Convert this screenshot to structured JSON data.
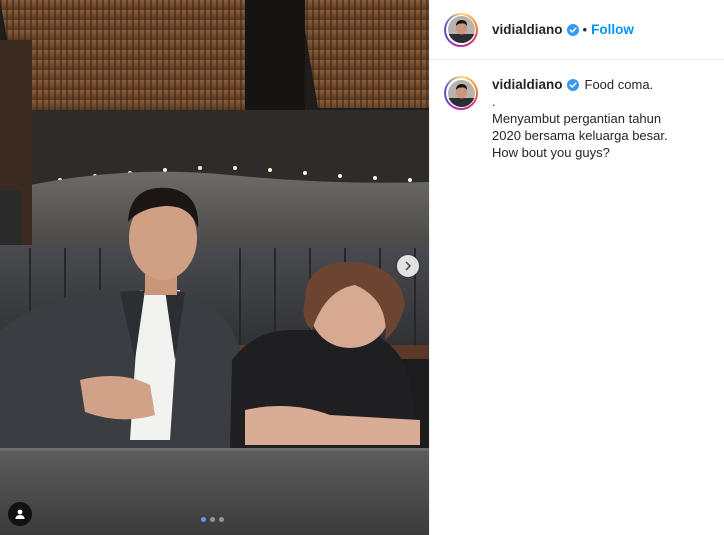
{
  "post": {
    "author": {
      "username": "vidialdiano",
      "verified": true
    },
    "follow_label": "Follow",
    "separator": "•",
    "caption": {
      "first_line": "Food coma.",
      "dot_line": ".",
      "body": "Menyambut pergantian tahun 2020 bersama keluarga besar. How bout you guys?"
    },
    "carousel": {
      "total": 3,
      "current": 1
    },
    "icons": {
      "verified": "verified-badge-icon",
      "next": "chevron-right-icon",
      "user_tag": "user-tag-icon"
    },
    "colors": {
      "link_blue": "#0095f6",
      "verified_blue": "#3897f0",
      "text": "#262626"
    }
  }
}
